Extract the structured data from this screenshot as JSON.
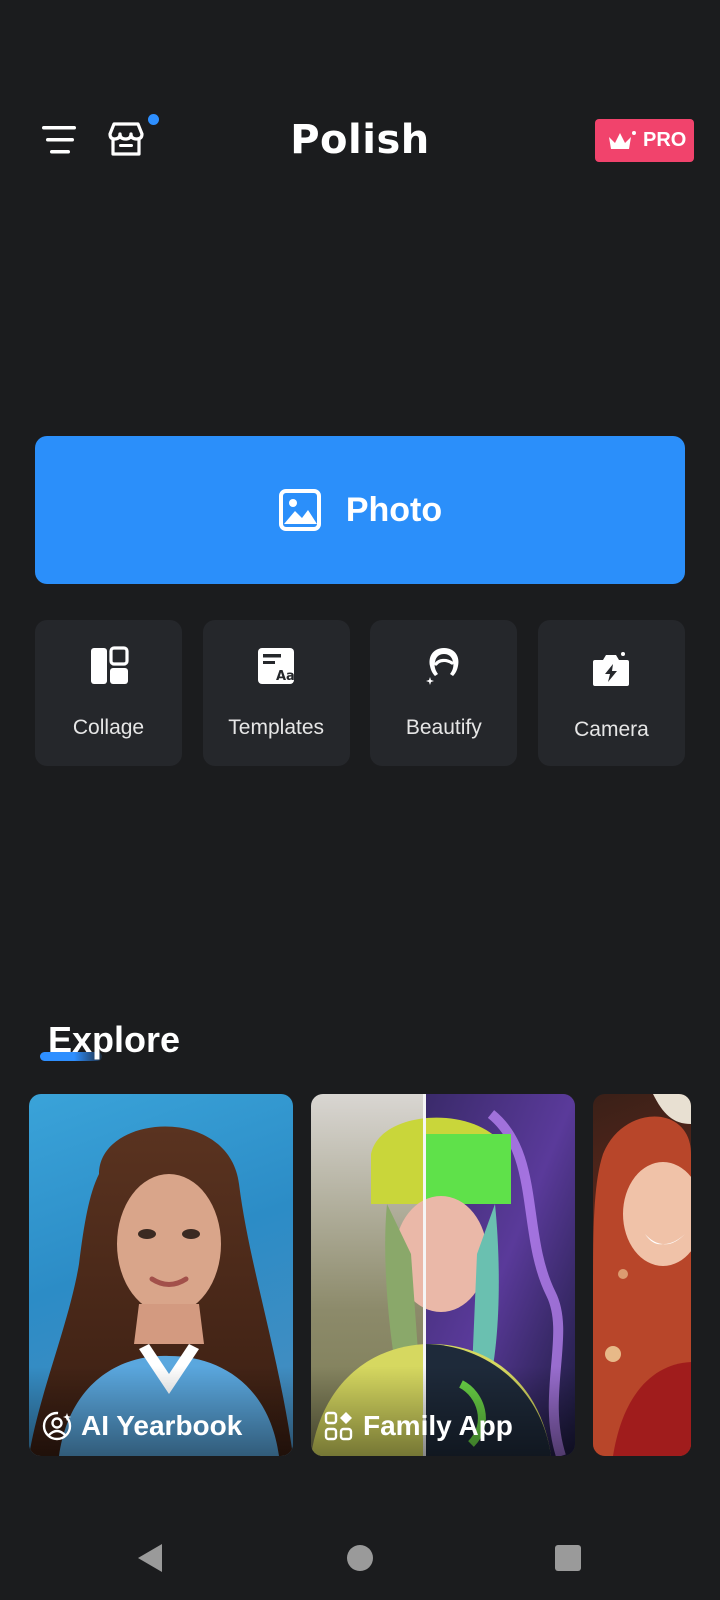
{
  "header": {
    "title": "Polish",
    "menu_icon": "hamburger-menu-icon",
    "store_icon": "store-icon",
    "has_notification": true,
    "pro_label": "PRO",
    "pro_icon": "crown-icon"
  },
  "primary_action": {
    "label": "Photo",
    "icon": "image-icon"
  },
  "tools": [
    {
      "label": "Collage",
      "icon": "collage-icon"
    },
    {
      "label": "Templates",
      "icon": "templates-icon"
    },
    {
      "label": "Beautify",
      "icon": "beautify-icon"
    },
    {
      "label": "Camera",
      "icon": "camera-icon"
    }
  ],
  "explore": {
    "title": "Explore",
    "cards": [
      {
        "label": "AI Yearbook",
        "icon": "ai-portrait-icon"
      },
      {
        "label": "Family App",
        "icon": "apps-grid-icon"
      },
      {
        "label": "",
        "icon": ""
      }
    ]
  },
  "navbar": {
    "back_icon": "back-triangle-icon",
    "home_icon": "home-circle-icon",
    "recents_icon": "recents-square-icon"
  },
  "colors": {
    "background": "#1b1c1e",
    "accent": "#2b8ffa",
    "pro_badge": "#f1436c",
    "tile": "#25272b"
  }
}
